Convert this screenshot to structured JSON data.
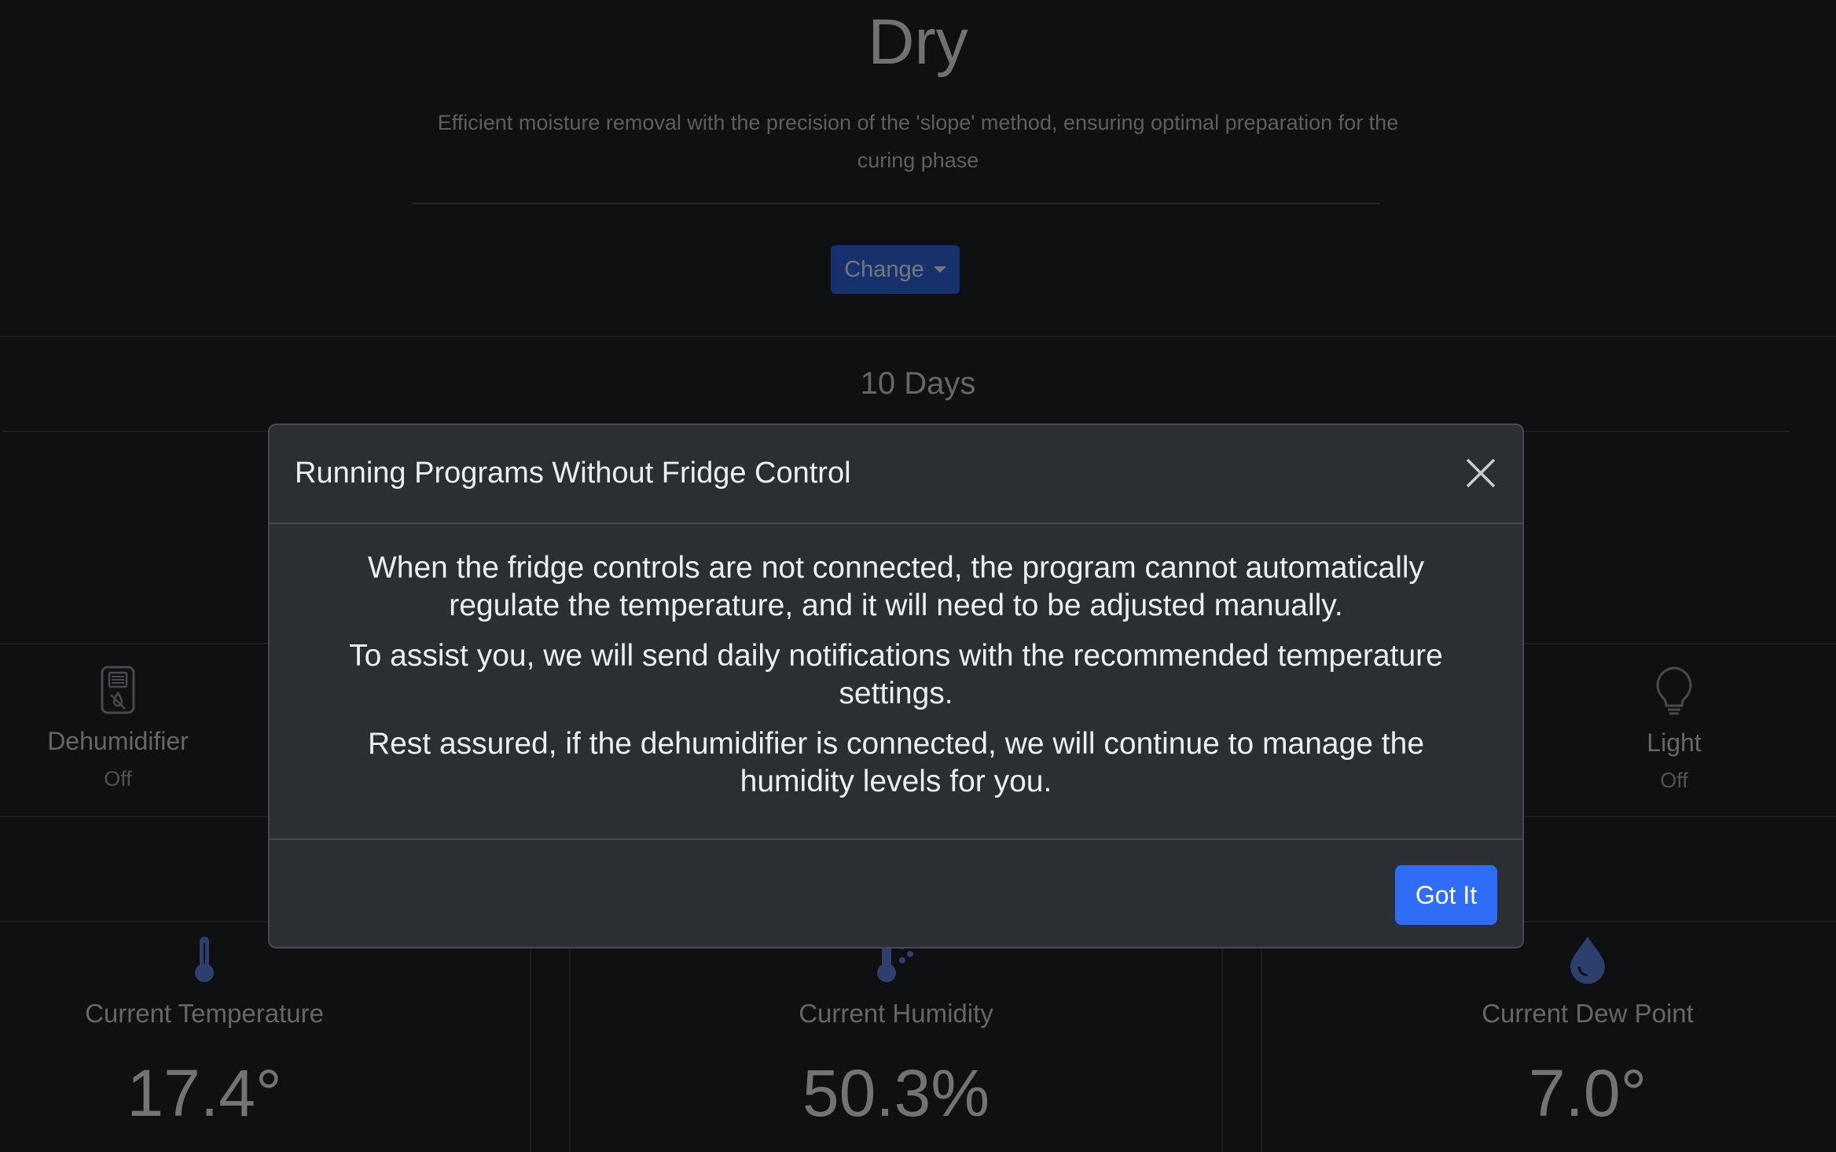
{
  "program": {
    "title": "Dry",
    "description": "Efficient moisture removal with the precision of the 'slope' method, ensuring optimal preparation for the curing phase",
    "change_label": "Change",
    "duration": "10 Days"
  },
  "devices": [
    {
      "name": "Dehumidifier",
      "state": "Off",
      "icon": "dehumidifier-icon"
    },
    {
      "name": "Light",
      "state": "Off",
      "icon": "lightbulb-icon"
    }
  ],
  "sensors": [
    {
      "label": "Current Temperature",
      "value": "17.4°",
      "icon": "thermometer-icon"
    },
    {
      "label": "Current Humidity",
      "value": "50.3%",
      "icon": "humidity-icon"
    },
    {
      "label": "Current Dew Point",
      "value": "7.0°",
      "icon": "droplet-icon"
    }
  ],
  "modal": {
    "title": "Running Programs Without Fridge Control",
    "paragraphs": [
      "When the fridge controls are not connected, the program cannot automatically regulate the temperature, and it will need to be adjusted manually.",
      "To assist you, we will send daily notifications with the recommended temperature settings.",
      "Rest assured, if the dehumidifier is connected, we will continue to manage the humidity levels for you."
    ],
    "confirm_label": "Got It"
  },
  "colors": {
    "background": "#1e2024",
    "primary": "#2f6df6",
    "icon_blue": "#5a7fd8",
    "modal_bg": "#2b2e33"
  }
}
